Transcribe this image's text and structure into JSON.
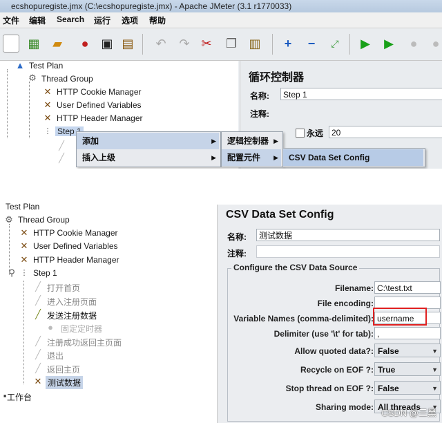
{
  "top": {
    "window_title": "ecshopuregiste.jmx (C:\\ecshopuregiste.jmx) - Apache JMeter (3.1 r1770033)",
    "menus": [
      "文件",
      "编辑",
      "Search",
      "运行",
      "选项",
      "帮助"
    ],
    "tree": {
      "test_plan": "Test Plan",
      "thread_group": "Thread Group",
      "cookie_manager": "HTTP Cookie Manager",
      "user_vars": "User Defined Variables",
      "header_manager": "HTTP Header Manager",
      "step1": "Step 1"
    },
    "right": {
      "heading": "循环控制器",
      "name_label": "名称:",
      "name_value": "Step 1",
      "comment_label": "注释:",
      "forever_label": "永远",
      "loop_value": "20"
    },
    "context_menu": {
      "add": "添加",
      "insert_parent": "插入上级",
      "logic_controller": "逻辑控制器",
      "config_element": "配置元件",
      "csv_config": "CSV Data Set Config"
    }
  },
  "bottom": {
    "tree": {
      "test_plan": "Test Plan",
      "thread_group": "Thread Group",
      "cookie_manager": "HTTP Cookie Manager",
      "user_vars": "User Defined Variables",
      "header_manager": "HTTP Header Manager",
      "step1": "Step 1",
      "open_home": "打开首页",
      "enter_register": "进入注册页面",
      "send_register": "发送注册数据",
      "timer": "固定定时器",
      "after_register": "注册成功返回主页面",
      "logout": "退出",
      "return_home": "返回主页",
      "test_data": "测试数据",
      "workbench": "工作台"
    },
    "panel": {
      "heading": "CSV Data Set Config",
      "name_label": "名称:",
      "name_value": "测试数据",
      "comment_label": "注释:",
      "section_title": "Configure the CSV Data Source",
      "fields": [
        {
          "label": "Filename:",
          "value": "C:\\test.txt"
        },
        {
          "label": "File encoding:",
          "value": ""
        },
        {
          "label": "Variable Names (comma-delimited):",
          "value": "username"
        },
        {
          "label": "Delimiter (use '\\t' for tab):",
          "value": ","
        }
      ],
      "dropdowns": [
        {
          "label": "Allow quoted data?:",
          "value": "False"
        },
        {
          "label": "Recycle on EOF ?:",
          "value": "True"
        },
        {
          "label": "Stop thread on EOF ?:",
          "value": "False"
        },
        {
          "label": "Sharing mode:",
          "value": "All threads"
        }
      ],
      "highlight_color": "#e02020"
    },
    "watermark": "CSDN @三黑"
  }
}
